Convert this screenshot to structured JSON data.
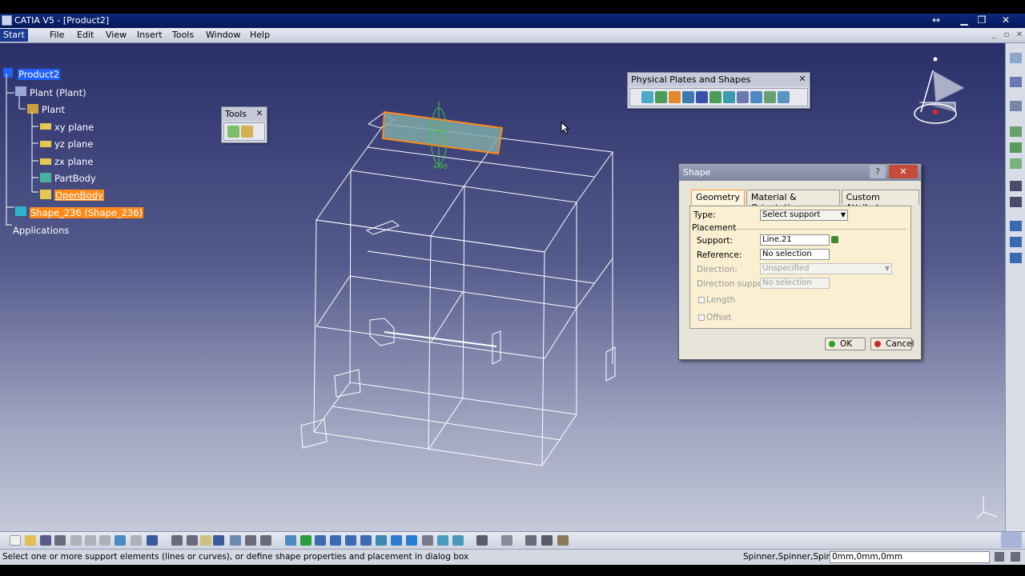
{
  "window": {
    "title": "CATIA V5 - [Product2]"
  },
  "menu": {
    "items": [
      "Start",
      "File",
      "Edit",
      "View",
      "Insert",
      "Tools",
      "Window",
      "Help"
    ]
  },
  "tree": {
    "product": "Product2",
    "plant_plant": "Plant (Plant)",
    "plant": "Plant",
    "xy": "xy plane",
    "yz": "yz plane",
    "zx": "zx plane",
    "partbody": "PartBody",
    "openbody": "OpenBody",
    "shape": "Shape_236 (Shape_236)",
    "applications": "Applications"
  },
  "toolbars": {
    "tools_title": "Tools",
    "plates_title": "Physical Plates and Shapes"
  },
  "viewport": {
    "manipulator_label": "+90"
  },
  "dialog": {
    "title": "Shape",
    "tabs": [
      "Geometry",
      "Material & Orientation",
      "Custom Attributes"
    ],
    "type_label": "Type:",
    "type_value": "Select support",
    "placement_label": "Placement",
    "support_label": "Support:",
    "support_value": "Line.21",
    "reference_label": "Reference:",
    "reference_value": "No selection",
    "direction_label": "Direction:",
    "direction_value": "Unspecified",
    "direction_support_label": "Direction support:",
    "direction_support_value": "No selection",
    "length_label": "Length",
    "offset_label": "Offset",
    "ok_label": "OK",
    "cancel_label": "Cancel"
  },
  "status": {
    "message": "Select one or more support elements (lines or curves), or define shape properties and placement in dialog box",
    "command": "Spinner,Spinner,Spinner",
    "command_input": "0mm,0mm,0mm"
  },
  "colors": {
    "selection_orange": "#ff8a1a",
    "selection_blue": "#2060ff",
    "viewport_top": "#2a2f6a",
    "viewport_bottom": "#c5c9d9",
    "dialog_panel": "#fbefd2"
  }
}
